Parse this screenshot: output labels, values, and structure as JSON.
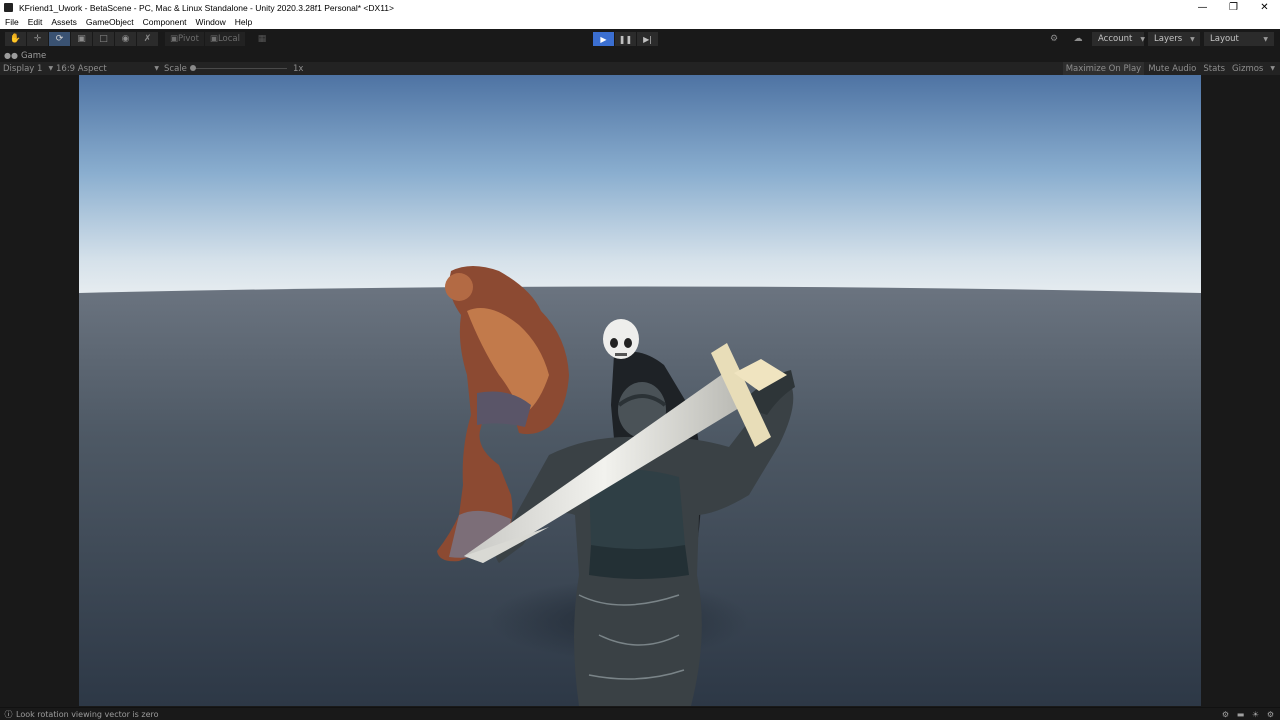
{
  "window": {
    "title": "KFriend1_Uwork - BetaScene - PC, Mac & Linux Standalone - Unity 2020.3.28f1 Personal* <DX11>",
    "controls": [
      "minimize-icon",
      "restore-icon",
      "close-icon"
    ]
  },
  "menu": [
    "File",
    "Edit",
    "Assets",
    "GameObject",
    "Component",
    "Window",
    "Help"
  ],
  "toolbar": {
    "tools": [
      "hand-icon",
      "move-icon",
      "rotate-icon",
      "scale-icon",
      "rect-icon",
      "transform-icon",
      "custom-tool-icon"
    ],
    "active_tool": "rotate-icon",
    "pivot_label": "Pivot",
    "local_label": "Local",
    "grid_icon": "grid-snap-icon",
    "play_state": "playing",
    "account_label": "Account",
    "layers_label": "Layers",
    "layout_label": "Layout",
    "accent": "#3b6fd1"
  },
  "game_tab": {
    "label": "Game"
  },
  "game_toolbar": {
    "display": "Display 1",
    "aspect": "16:9 Aspect",
    "scale_label": "Scale",
    "scale_value": "1x",
    "maximize_on_play": "Maximize On Play",
    "mute_audio": "Mute Audio",
    "stats": "Stats",
    "gizmos": "Gizmos"
  },
  "status": {
    "message": "Look rotation viewing vector is zero"
  }
}
